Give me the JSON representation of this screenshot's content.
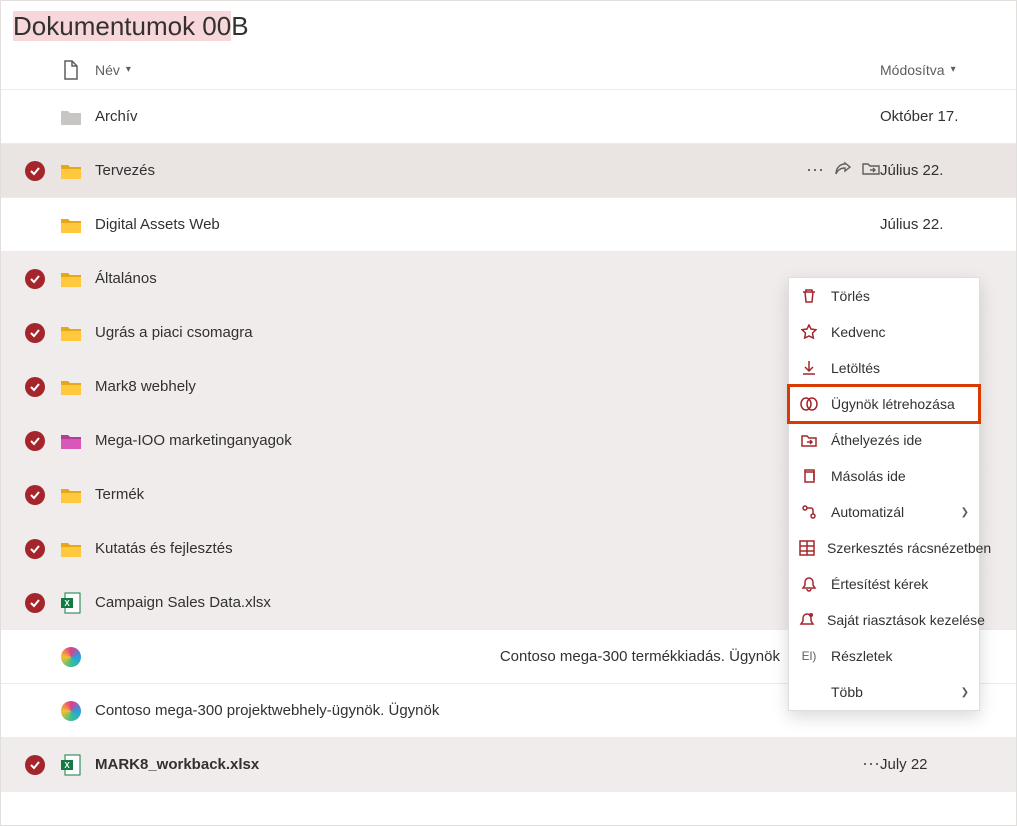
{
  "page": {
    "title_hl": "Dokumentumok 00",
    "title_rest": "B"
  },
  "header": {
    "name_col": "Név",
    "mod_col": "Módosítva"
  },
  "rows": [
    {
      "selected": false,
      "icon": "folder-grey",
      "name": "Archív",
      "mod": "Október 17.",
      "showActions": false
    },
    {
      "selected": true,
      "icon": "folder-yellow",
      "name": "Tervezés",
      "mod": "Július 22.",
      "showActions": true,
      "hover": true
    },
    {
      "selected": false,
      "icon": "folder-yellow",
      "name": "Digital Assets Web",
      "mod": "Július 22.",
      "showActions": false
    },
    {
      "selected": true,
      "icon": "folder-yellow",
      "name": "Általános",
      "mod": "",
      "showActions": true
    },
    {
      "selected": true,
      "icon": "folder-yellow",
      "name": "Ugrás a piaci csomagra",
      "mod": "",
      "showActions": true
    },
    {
      "selected": true,
      "icon": "folder-yellow",
      "name": "Mark8 webhely",
      "mod": "",
      "showActions": false
    },
    {
      "selected": true,
      "icon": "folder-pink",
      "name": "Mega-IOO marketinganyagok",
      "mod": "",
      "showActions": false
    },
    {
      "selected": true,
      "icon": "folder-yellow",
      "name": "Termék",
      "mod": "",
      "showActions": false
    },
    {
      "selected": true,
      "icon": "folder-yellow",
      "name": "Kutatás és fejlesztés",
      "mod": "",
      "showActions": true
    },
    {
      "selected": true,
      "icon": "excel",
      "name": "Campaign Sales Data.xlsx",
      "mod": "",
      "showActions": false
    },
    {
      "selected": false,
      "icon": "copilot",
      "name": "",
      "right_text": "Contoso mega-300 termékkiadás. Ügynök",
      "mod": "",
      "showActions": false
    },
    {
      "selected": false,
      "icon": "copilot",
      "name": "Contoso mega-300 projektwebhely-ügynök. Ügynök",
      "mod": "",
      "showActions": false
    },
    {
      "selected": true,
      "icon": "excel",
      "name": "MARK8_workback.xlsx",
      "mod": "July 22",
      "showActions": true,
      "bold": true
    }
  ],
  "context": [
    {
      "icon": "trash",
      "label": "Törlés"
    },
    {
      "icon": "star",
      "label": "Kedvenc"
    },
    {
      "icon": "download",
      "label": "Letöltés"
    },
    {
      "icon": "copilot-o",
      "label": "Ügynök létrehozása",
      "highlight": true
    },
    {
      "icon": "folder-go",
      "label": "Áthelyezés ide"
    },
    {
      "icon": "copy",
      "label": "Másolás ide"
    },
    {
      "icon": "flow",
      "label": "Automatizál",
      "submenu": true
    },
    {
      "icon": "grid",
      "label": "Szerkesztés rácsnézetben"
    },
    {
      "icon": "bell",
      "label": "Értesítést kérek"
    },
    {
      "icon": "alert",
      "label": "Saját riasztások kezelése"
    },
    {
      "icon": "text",
      "text_icon": "El)",
      "label": "Részletek"
    },
    {
      "icon": "none",
      "label": "Több",
      "submenu": true
    }
  ]
}
